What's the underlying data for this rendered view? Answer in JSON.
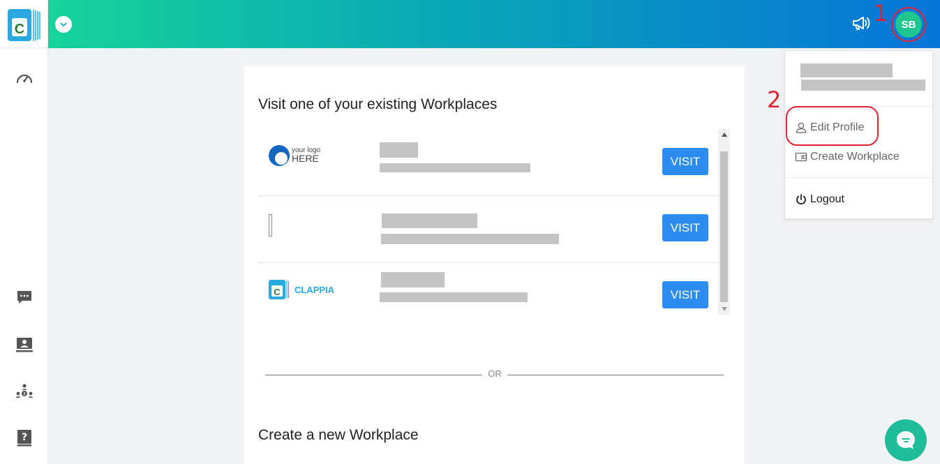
{
  "header": {
    "avatar_initials": "SB",
    "icons": [
      "chevron-down-icon",
      "megaphone-icon"
    ]
  },
  "sidebar": {
    "brand_letter": "C",
    "items": [
      {
        "icon": "speedometer-icon"
      },
      {
        "icon": "chat-icon"
      },
      {
        "icon": "contact-card-icon"
      },
      {
        "icon": "team-help-icon"
      },
      {
        "icon": "help-book-icon"
      }
    ]
  },
  "annotations": {
    "step1": "1",
    "step2": "2"
  },
  "main": {
    "existing_heading": "Visit one of your existing Workplaces",
    "visit_label": "VISIT",
    "workplaces": [
      {
        "logo_line1": "your logo",
        "logo_line2": "HERE"
      },
      {},
      {
        "logo_text": "CLAPPIA",
        "logo_letter": "C"
      }
    ],
    "or_label": "OR",
    "create_heading": "Create a new Workplace"
  },
  "menu": {
    "edit_profile": "Edit Profile",
    "create_workplace": "Create Workplace",
    "logout": "Logout"
  },
  "colors": {
    "accent": "#2d8cf0",
    "annotation_red": "#e2232f",
    "avatar_green": "#1fc68f",
    "gradient_start": "#17d39a",
    "gradient_end": "#0674d8"
  }
}
